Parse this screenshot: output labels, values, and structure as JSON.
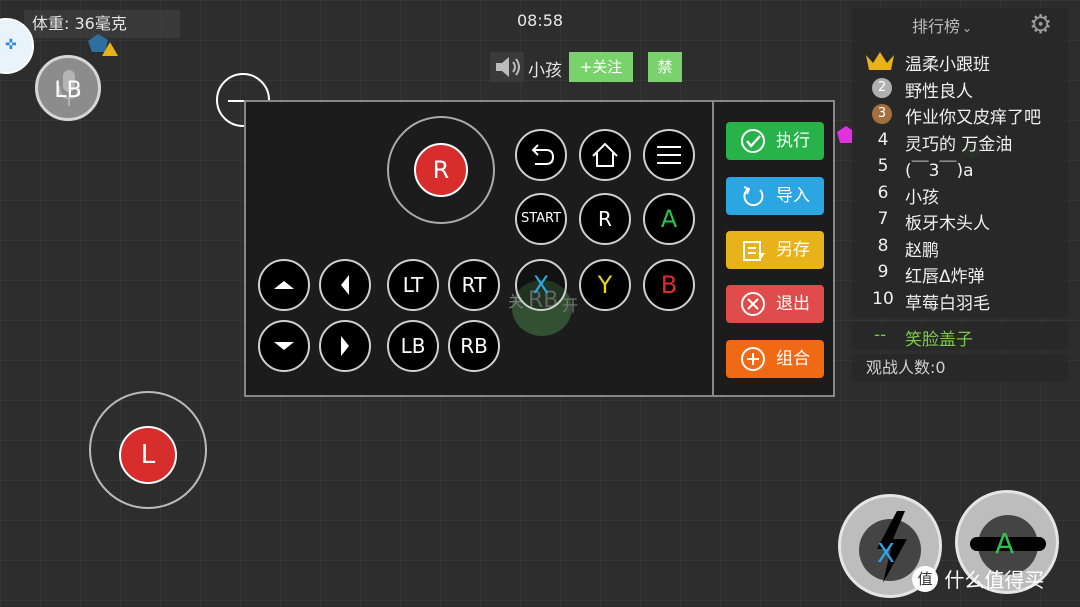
{
  "hud": {
    "weight": "体重: 36毫克",
    "time": "08:58",
    "lb_button": "LB"
  },
  "speaker": {
    "name": "小孩",
    "follow_label": "+关注",
    "ban_label": "禁"
  },
  "panel": {
    "joystick_r": "R",
    "icons_row": [
      "undo-icon",
      "home-icon",
      "menu-icon"
    ],
    "start_label": "START",
    "r_label": "R",
    "a_label": "A",
    "lt_label": "LT",
    "rt_label": "RT",
    "x_label": "X",
    "y_label": "Y",
    "b_label": "B",
    "lb_label": "LB",
    "rb_label": "RB",
    "ghost_label": "RB",
    "ghost_left": "关",
    "ghost_right": "开",
    "actions": [
      {
        "label": "执行",
        "color": "#27b24a",
        "icon": "check-icon"
      },
      {
        "label": "导入",
        "color": "#2ba6e2",
        "icon": "import-icon"
      },
      {
        "label": "另存",
        "color": "#e8b21a",
        "icon": "save-icon"
      },
      {
        "label": "退出",
        "color": "#e04b4b",
        "icon": "close-icon"
      },
      {
        "label": "组合",
        "color": "#f06a16",
        "icon": "plus-icon"
      }
    ]
  },
  "joystick_l": "L",
  "leaderboard": {
    "title": "排行榜",
    "rows": [
      {
        "rank": "",
        "name": "温柔小跟班",
        "medal": "crown"
      },
      {
        "rank": "2",
        "name": "野性良人",
        "medal": "silver"
      },
      {
        "rank": "3",
        "name": "作业你又皮痒了吧",
        "medal": "bronze"
      },
      {
        "rank": "4",
        "name": "灵巧的 万金油"
      },
      {
        "rank": "5",
        "name": "(￣3￣)a"
      },
      {
        "rank": "6",
        "name": "小孩"
      },
      {
        "rank": "7",
        "name": "板牙木头人"
      },
      {
        "rank": "8",
        "name": "赵鹏"
      },
      {
        "rank": "9",
        "name": "红唇Δ炸弹"
      },
      {
        "rank": "10",
        "name": "草莓白羽毛"
      }
    ],
    "self_rank": "--",
    "self_name": "笑脸盖子",
    "spectators": "观战人数:0"
  },
  "bottom_buttons": {
    "x_label": "X",
    "a_label": "A"
  },
  "watermark": "值 什么值得买",
  "colors": {
    "green_action": "#27b24a",
    "red_joystick": "#d82d2d",
    "x_blue": "#2aa8e8",
    "y_yellow": "#e8d21a",
    "b_red": "#e02b2b",
    "a_green": "#2cc24a"
  }
}
